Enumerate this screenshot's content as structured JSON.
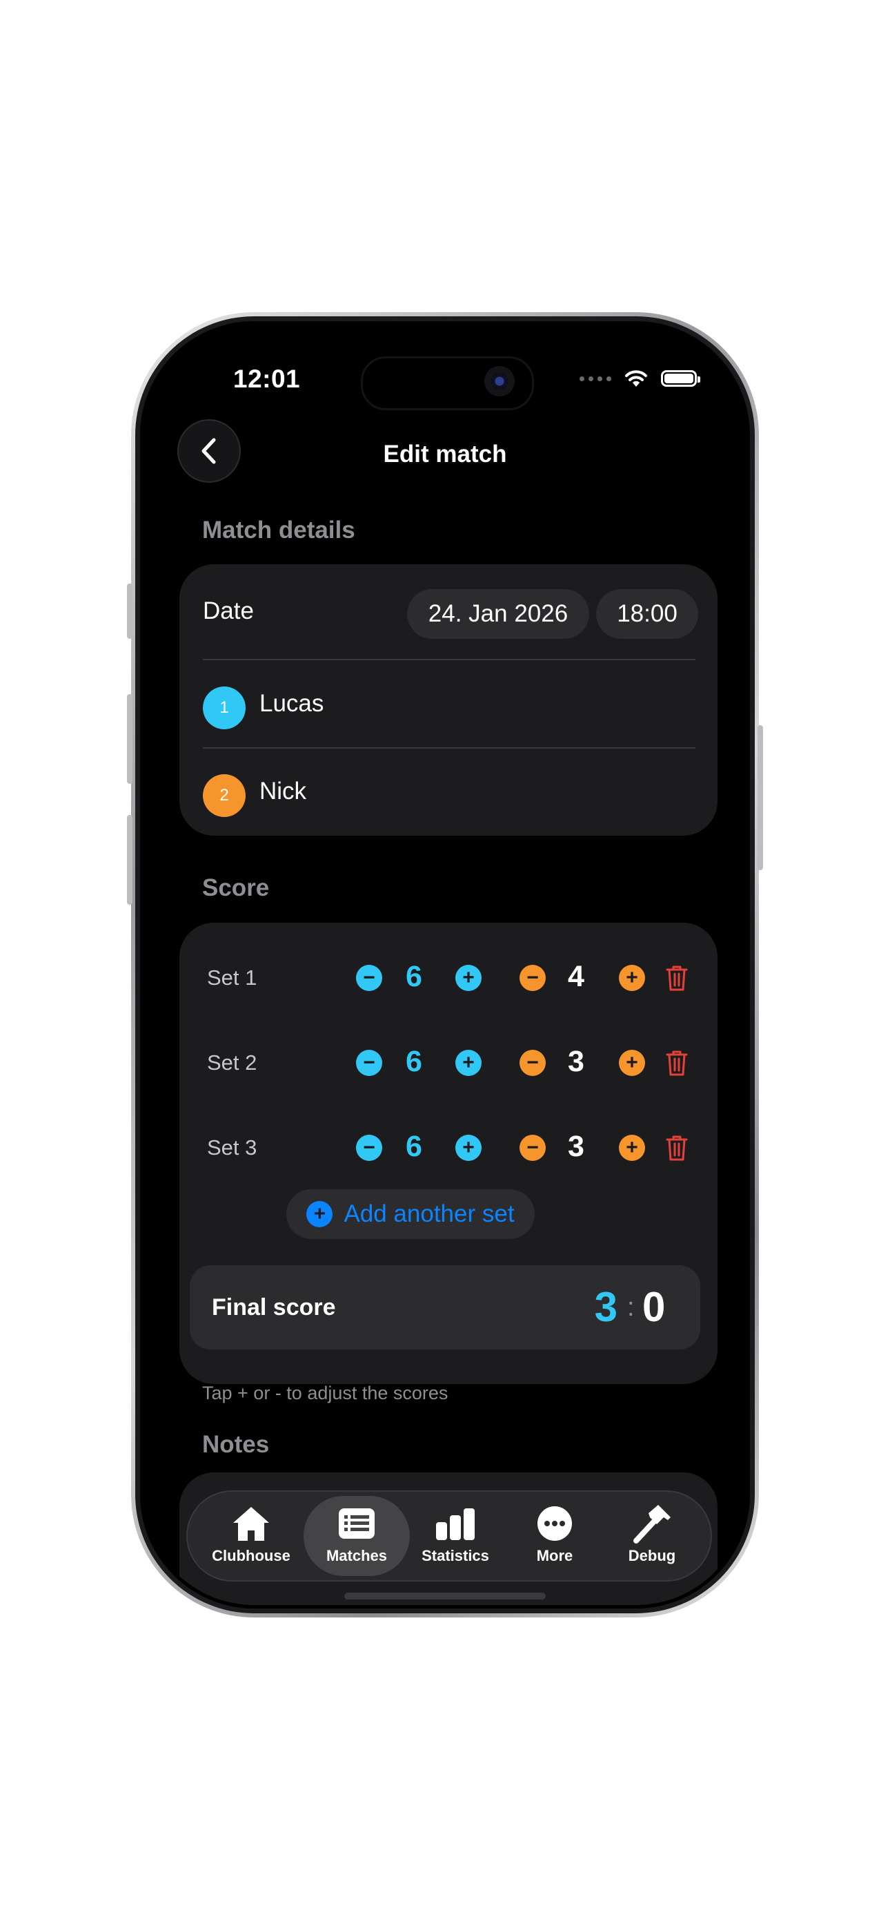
{
  "status": {
    "time": "12:01"
  },
  "nav": {
    "title": "Edit match",
    "back_icon": "chevron-left-icon"
  },
  "match_details": {
    "section_title": "Match details",
    "date_label": "Date",
    "date_value": "24. Jan 2026",
    "time_value": "18:00",
    "players": [
      {
        "number": "1",
        "name": "Lucas",
        "color": "#32c8f5"
      },
      {
        "number": "2",
        "name": "Nick",
        "color": "#f6952c"
      }
    ]
  },
  "score": {
    "section_title": "Score",
    "sets": [
      {
        "label": "Set 1",
        "player1": "6",
        "player2": "4"
      },
      {
        "label": "Set 2",
        "player1": "6",
        "player2": "3"
      },
      {
        "label": "Set 3",
        "player1": "6",
        "player2": "3"
      }
    ],
    "add_set_label": "Add another set",
    "final_label": "Final score",
    "final_player1": "3",
    "final_separator": ":",
    "final_player2": "0",
    "hint": "Tap + or - to adjust the scores"
  },
  "notes": {
    "section_title": "Notes"
  },
  "tabbar": {
    "active": "Matches",
    "items": [
      {
        "label": "Clubhouse",
        "icon": "house-icon"
      },
      {
        "label": "Matches",
        "icon": "list-icon"
      },
      {
        "label": "Statistics",
        "icon": "bar-chart-icon"
      },
      {
        "label": "More",
        "icon": "ellipsis-icon"
      },
      {
        "label": "Debug",
        "icon": "hammer-icon"
      }
    ]
  },
  "colors": {
    "player1": "#32c8f5",
    "player2": "#f6952c",
    "accent": "#0a84ff",
    "delete": "#e5413a",
    "card": "#1c1c1e"
  }
}
